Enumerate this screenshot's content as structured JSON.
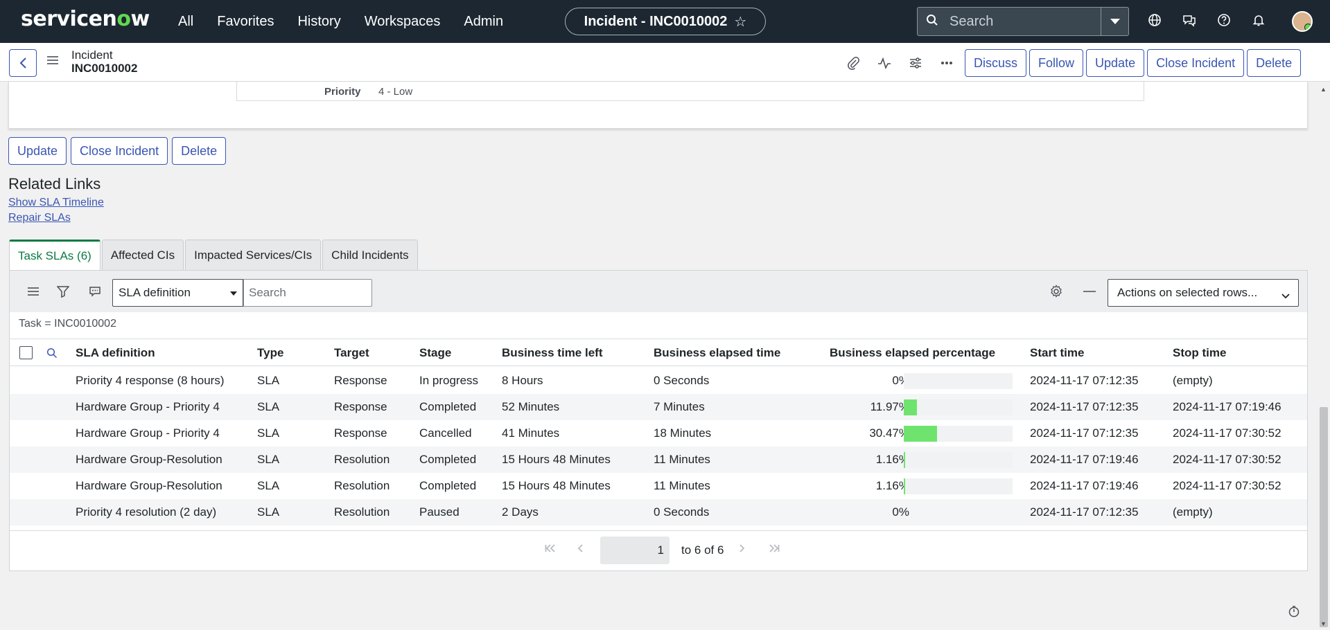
{
  "topnav": {
    "logo_prefix": "servicen",
    "logo_o": "o",
    "logo_suffix": "w",
    "menu": [
      "All",
      "Favorites",
      "History",
      "Workspaces",
      "Admin"
    ],
    "context_title": "Incident - INC0010002",
    "star": "☆",
    "search_placeholder": "Search"
  },
  "form_header": {
    "record_type": "Incident",
    "record_number": "INC0010002",
    "buttons": [
      "Discuss",
      "Follow",
      "Update",
      "Close Incident",
      "Delete"
    ]
  },
  "top_card": {
    "priority_label": "Priority",
    "priority_value": "4 - Low"
  },
  "bottom_buttons": [
    "Update",
    "Close Incident",
    "Delete"
  ],
  "related_links": {
    "title": "Related Links",
    "links": [
      "Show SLA Timeline",
      "Repair SLAs"
    ]
  },
  "tabs": [
    "Task SLAs (6)",
    "Affected CIs",
    "Impacted Services/CIs",
    "Child Incidents"
  ],
  "list": {
    "field_select": "SLA definition",
    "search_placeholder": "Search",
    "actions_select": "Actions on selected rows...",
    "breadcrumb": "Task = INC0010002",
    "columns": [
      "SLA definition",
      "Type",
      "Target",
      "Stage",
      "Business time left",
      "Business elapsed time",
      "Business elapsed percentage",
      "Start time",
      "Stop time"
    ],
    "rows": [
      {
        "sla": "Priority 4 response (8 hours)",
        "type": "SLA",
        "target": "Response",
        "stage": "In progress",
        "time_left": "8 Hours",
        "elapsed": "0 Seconds",
        "pct": "0%",
        "pct_value": 0,
        "start": "2024-11-17 07:12:35",
        "stop": "(empty)"
      },
      {
        "sla": "Hardware Group - Priority 4",
        "type": "SLA",
        "target": "Response",
        "stage": "Completed",
        "time_left": "52 Minutes",
        "elapsed": "7 Minutes",
        "pct": "11.97%",
        "pct_value": 11.97,
        "start": "2024-11-17 07:12:35",
        "stop": "2024-11-17 07:19:46"
      },
      {
        "sla": "Hardware Group - Priority 4",
        "type": "SLA",
        "target": "Response",
        "stage": "Cancelled",
        "time_left": "41 Minutes",
        "elapsed": "18 Minutes",
        "pct": "30.47%",
        "pct_value": 30.47,
        "start": "2024-11-17 07:12:35",
        "stop": "2024-11-17 07:30:52"
      },
      {
        "sla": "Hardware Group-Resolution",
        "type": "SLA",
        "target": "Resolution",
        "stage": "Completed",
        "time_left": "15 Hours 48 Minutes",
        "elapsed": "11 Minutes",
        "pct": "1.16%",
        "pct_value": 1.16,
        "start": "2024-11-17 07:19:46",
        "stop": "2024-11-17 07:30:52"
      },
      {
        "sla": "Hardware Group-Resolution",
        "type": "SLA",
        "target": "Resolution",
        "stage": "Completed",
        "time_left": "15 Hours 48 Minutes",
        "elapsed": "11 Minutes",
        "pct": "1.16%",
        "pct_value": 1.16,
        "start": "2024-11-17 07:19:46",
        "stop": "2024-11-17 07:30:52"
      },
      {
        "sla": "Priority 4 resolution (2 day)",
        "type": "SLA",
        "target": "Resolution",
        "stage": "Paused",
        "time_left": "2 Days",
        "elapsed": "0 Seconds",
        "pct": "0%",
        "pct_value": null,
        "start": "2024-11-17 07:12:35",
        "stop": "(empty)"
      }
    ],
    "pager": {
      "page": "1",
      "range": "to 6 of 6"
    }
  },
  "colors": {
    "nav_bg": "#1c2731",
    "accent": "#3955b3",
    "tab_active": "#0b7a43",
    "bar_fill": "#6ee46f",
    "logo_o": "#62d84e"
  }
}
